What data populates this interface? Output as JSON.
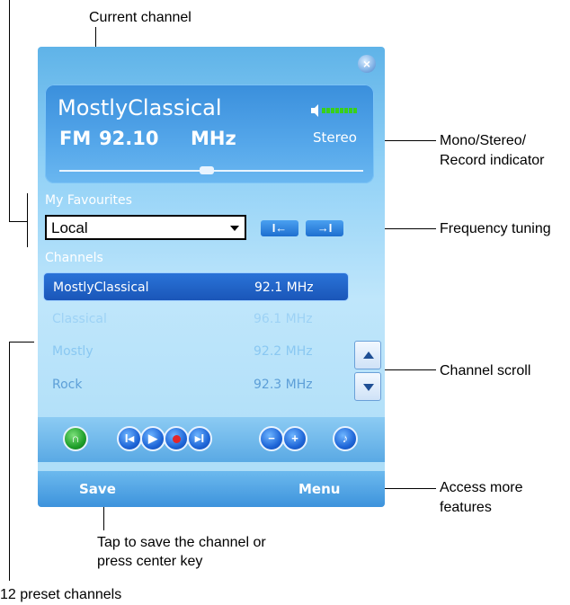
{
  "annotations": {
    "current_channel": "Current channel",
    "indicator_line1": "Mono/Stereo/",
    "indicator_line2": "Record indicator",
    "frequency_tuning": "Frequency tuning",
    "channel_scroll": "Channel scroll",
    "more_line1": "Access more",
    "more_line2": "features",
    "save_line1": "Tap to save the channel or",
    "save_line2": "press center key",
    "presets": "12 preset channels"
  },
  "display": {
    "channel_name": "MostlyClassical",
    "band": "FM",
    "frequency": "92.10",
    "unit": "MHz",
    "audio_mode": "Stereo"
  },
  "favourites": {
    "label": "My Favourites",
    "selected": "Local"
  },
  "channels": {
    "label": "Channels",
    "items": [
      {
        "name": "MostlyClassical",
        "freq": "92.1 MHz"
      },
      {
        "name": "Classical",
        "freq": "96.1 MHz"
      },
      {
        "name": "Mostly",
        "freq": "92.2 MHz"
      },
      {
        "name": "Rock",
        "freq": "92.3 MHz"
      }
    ],
    "selected_index": 0
  },
  "softkeys": {
    "left": "Save",
    "right": "Menu"
  },
  "colors": {
    "accent": "#1f66d8",
    "selected_row": "#1d5fc8",
    "volume_green": "#38d11a"
  }
}
